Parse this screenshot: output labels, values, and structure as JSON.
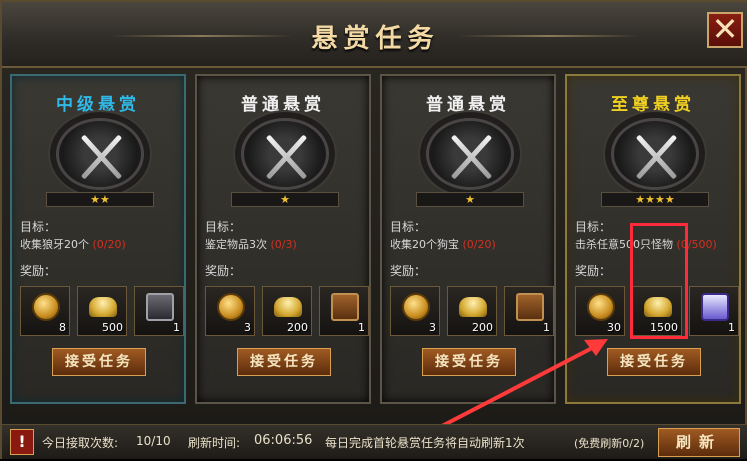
{
  "window": {
    "title": "悬赏任务",
    "close_glyph": "✕"
  },
  "cards": [
    {
      "title": "中级悬赏",
      "title_color": "#2fb8e8",
      "stars": "★★",
      "target_label": "目标：",
      "target": "收集狼牙20个",
      "progress": "(0/20)",
      "reward_label": "奖励：",
      "rewards": [
        {
          "icon": "coin-icon",
          "count": "8"
        },
        {
          "icon": "gold-ingot-icon",
          "count": "500"
        },
        {
          "icon": "silver-chest-icon",
          "count": "1"
        }
      ],
      "accept_label": "接受任务"
    },
    {
      "title": "普通悬赏",
      "title_color": "#f0f0f0",
      "stars": "★",
      "target_label": "目标：",
      "target": "鉴定物品3次",
      "progress": "(0/3)",
      "reward_label": "奖励：",
      "rewards": [
        {
          "icon": "coin-icon",
          "count": "3"
        },
        {
          "icon": "gold-ingot-icon",
          "count": "200"
        },
        {
          "icon": "wooden-chest-icon",
          "count": "1"
        }
      ],
      "accept_label": "接受任务"
    },
    {
      "title": "普通悬赏",
      "title_color": "#f0f0f0",
      "stars": "★",
      "target_label": "目标：",
      "target": "收集20个狗宝",
      "progress": "(0/20)",
      "reward_label": "奖励：",
      "rewards": [
        {
          "icon": "coin-icon",
          "count": "3"
        },
        {
          "icon": "gold-ingot-icon",
          "count": "200"
        },
        {
          "icon": "wooden-chest-icon",
          "count": "1"
        }
      ],
      "accept_label": "接受任务"
    },
    {
      "title": "至尊悬赏",
      "title_color": "#f0d020",
      "stars": "★★★★",
      "target_label": "目标：",
      "target": "击杀任意500只怪物",
      "progress": "(0/500)",
      "reward_label": "奖励：",
      "rewards": [
        {
          "icon": "coin-icon",
          "count": "30"
        },
        {
          "icon": "gold-ingot-icon",
          "count": "1500"
        },
        {
          "icon": "scroll-icon",
          "count": "1"
        }
      ],
      "accept_label": "接受任务"
    }
  ],
  "footer": {
    "alert_glyph": "!",
    "count_label": "今日接取次数:",
    "count_value": "10/10",
    "refresh_label": "刷新时间:",
    "refresh_time": "06:06:56",
    "refresh_note": "每日完成首轮悬赏任务将自动刷新1次",
    "free_refresh": "(免费刷新0/2)",
    "refresh_button": "刷新"
  },
  "colors": {
    "highlight": "#ff2a3a"
  }
}
